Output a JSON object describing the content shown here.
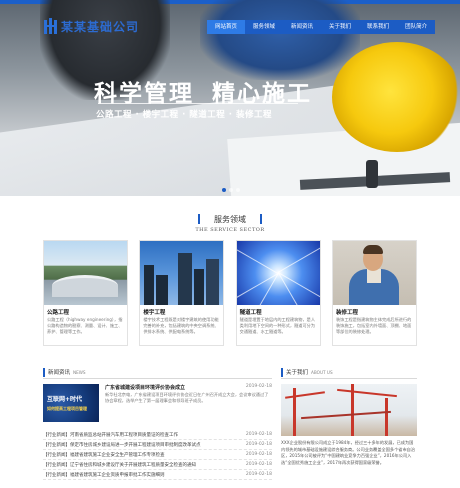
{
  "brand": {
    "name": "某某基础公司",
    "accent": "#1c5cc4"
  },
  "nav": {
    "items": [
      {
        "label": "网站首页",
        "active": true
      },
      {
        "label": "服务领域",
        "active": false
      },
      {
        "label": "新闻资讯",
        "active": false
      },
      {
        "label": "关于我们",
        "active": false
      },
      {
        "label": "联系我们",
        "active": false
      },
      {
        "label": "团队简介",
        "active": false
      }
    ]
  },
  "hero": {
    "slogan_left": "科学管理",
    "slogan_right": "精心施工",
    "subslogan": "公路工程 · 楼宇工程 · 隧道工程 · 装修工程"
  },
  "services": {
    "title": "服务领域",
    "subtitle": "THE SERVICE SECTOR",
    "cards": [
      {
        "title": "公路工程",
        "desc": "公路工程（highway engineering），指公路构造物的勘察、测量、设计、施工、养护、管理等工作。"
      },
      {
        "title": "楼宇工程",
        "desc": "楼宇技术工程既是对楼宇建筑的使用功能完善的补充，包括建筑的中央空调系统、供排水系统、供配电系统等。"
      },
      {
        "title": "隧道工程",
        "desc": "隧道是埋置于地层内的工程建筑物，是人类利用地下空间的一种形式，隧道可分为交通隧道、水工隧道等。"
      },
      {
        "title": "装修工程",
        "desc": "装饰工程是指建筑物主体完成后所进行的装饰施工，包括室内外墙面、顶棚、地面等部位的装修处理。"
      }
    ]
  },
  "news": {
    "title": "新闻资讯",
    "title_en": "NEWS",
    "featured": {
      "title": "广东省城建设项目环境评价协会成立",
      "date": "2019-02-18",
      "desc": "新华社北京电，广东省建设项目环境评价协会近日在广州召开成立大会，会议审议通过了协会章程，选举产生了第一届理事会和领导班子成员。",
      "thumb_line1": "互联网+时代",
      "thumb_line2": "如何提高工程项目管理"
    },
    "items": [
      {
        "title": "【行业新闻】河南省质监总站开展汽车用工程项目质量证的检查工作",
        "date": "2019-02-18"
      },
      {
        "title": "【行业新闻】保定市住房城乡建设局进一步开展工程建设项目审批制度改革试点",
        "date": "2019-02-18"
      },
      {
        "title": "【行业新闻】福建省建筑施工企业安全生产管理工作专项检查",
        "date": "2019-02-18"
      },
      {
        "title": "【行业新闻】辽宁省住房和城乡建设厅关于开展建筑工程质量安全检查的通知",
        "date": "2019-02-18"
      },
      {
        "title": "【行业新闻】福建省建筑施工企业资质申报审批工作实施细则",
        "date": "2019-02-18"
      }
    ]
  },
  "about": {
    "title": "关于我们",
    "title_en": "ABOUT US",
    "text": "XXX企业股份有限公司成立于1984年，经过三十多年的发展，已成为国内领先的城市基础设施建设综合服务商。公司业务覆盖全国多个省市自治区，2015年公司被评为“中国建筑业竞争力百强企业”，2016年公司入选“全国优秀施工企业”，2017年再次获得国家级荣誉。"
  }
}
